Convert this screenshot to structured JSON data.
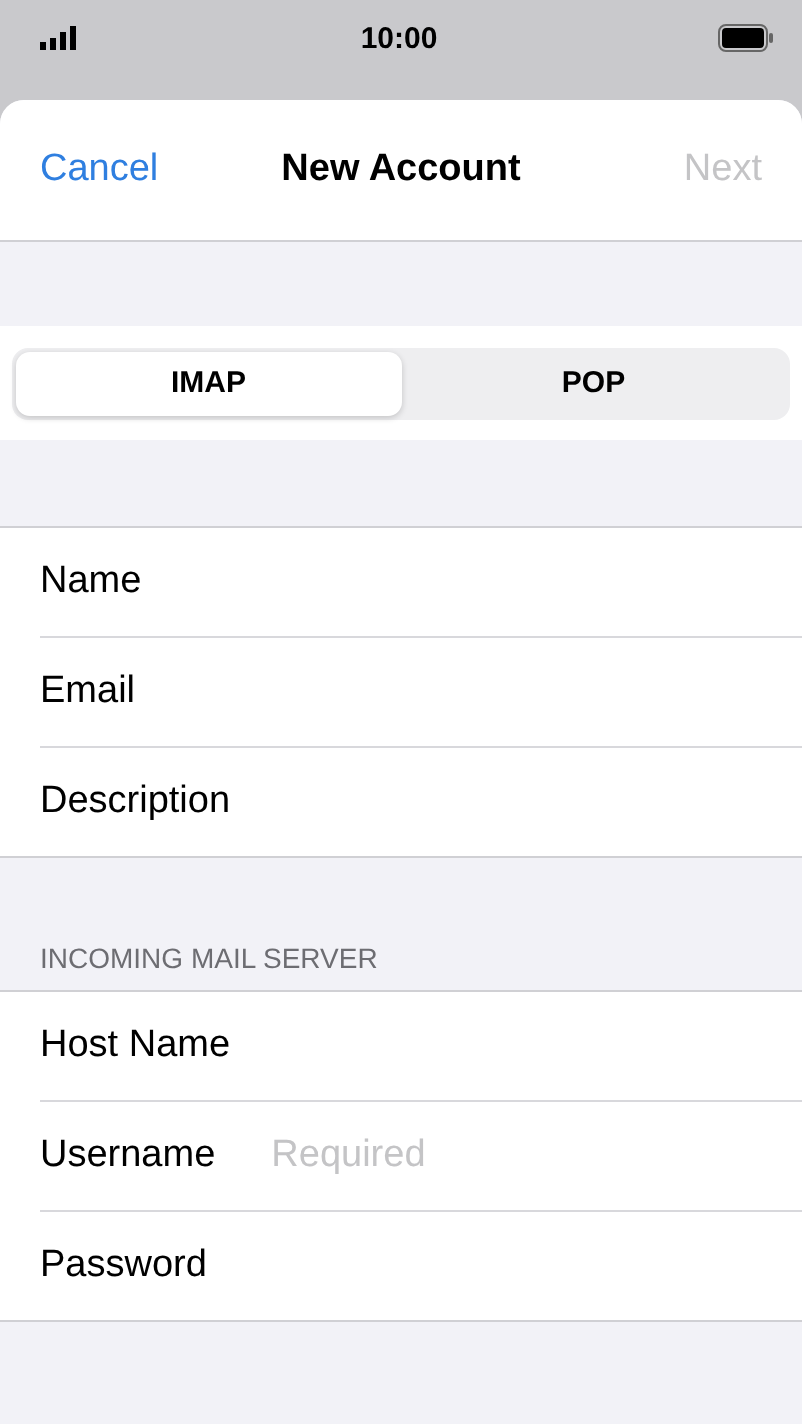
{
  "status_bar": {
    "time": "10:00"
  },
  "sheet": {
    "cancel": "Cancel",
    "title": "New Account",
    "next": {
      "label": "Next",
      "disabled": true
    }
  },
  "segments": [
    {
      "label": "IMAP",
      "selected": true
    },
    {
      "label": "POP",
      "selected": false
    }
  ],
  "sections": [
    {
      "fields": [
        {
          "label": "Name"
        },
        {
          "label": "Email"
        },
        {
          "label": "Description"
        }
      ]
    },
    {
      "header": "INCOMING MAIL SERVER",
      "fields": [
        {
          "label": "Host Name"
        },
        {
          "label": "Username",
          "placeholder": "Required"
        },
        {
          "label": "Password"
        }
      ]
    }
  ]
}
